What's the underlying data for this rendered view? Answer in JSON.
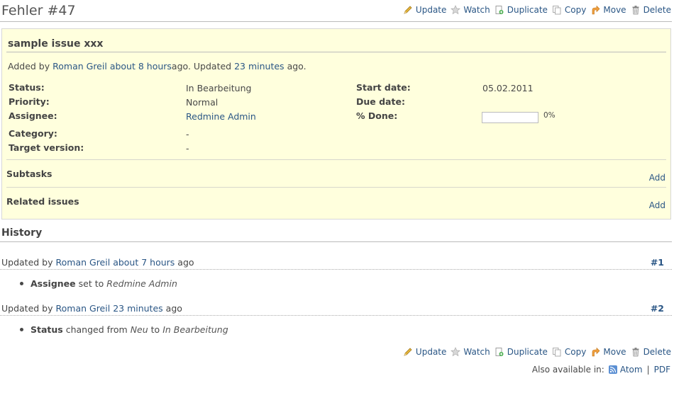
{
  "issue": {
    "title": "Fehler #47",
    "subject": "sample issue xxx",
    "author_prefix": "Added by",
    "author": "Roman Greil",
    "added_ago": "about 8 hours",
    "added_suffix": "ago. Updated",
    "updated_ago": "23 minutes",
    "updated_suffix": "ago."
  },
  "actions": {
    "update": "Update",
    "watch": "Watch",
    "duplicate": "Duplicate",
    "copy": "Copy",
    "move": "Move",
    "delete": "Delete"
  },
  "attributes": {
    "status_label": "Status:",
    "status_value": "In Bearbeitung",
    "priority_label": "Priority:",
    "priority_value": "Normal",
    "assignee_label": "Assignee:",
    "assignee_value": "Redmine Admin",
    "category_label": "Category:",
    "category_value": "-",
    "target_label": "Target version:",
    "target_value": "-",
    "start_label": "Start date:",
    "start_value": "05.02.2011",
    "due_label": "Due date:",
    "due_value": "",
    "done_label": "% Done:",
    "done_value": "0%",
    "done_fraction": 0
  },
  "sections": {
    "subtasks": "Subtasks",
    "related": "Related issues",
    "add": "Add"
  },
  "history": {
    "title": "History",
    "journals": [
      {
        "prefix": "Updated by",
        "author": "Roman Greil",
        "ago": "about 7 hours",
        "suffix": "ago",
        "number": "#1",
        "field": "Assignee",
        "verb": "set to",
        "new_value": "Redmine Admin"
      },
      {
        "prefix": "Updated by",
        "author": "Roman Greil",
        "ago": "23 minutes",
        "suffix": "ago",
        "number": "#2",
        "field": "Status",
        "verb": "changed from",
        "old_value": "Neu",
        "to": "to",
        "new_value": "In Bearbeitung"
      }
    ]
  },
  "footer": {
    "also_available": "Also available in:",
    "atom": "Atom",
    "separator": "|",
    "pdf": "PDF"
  },
  "icons": {
    "update": "pencil-icon",
    "watch": "star-icon",
    "duplicate": "duplicate-icon",
    "copy": "copy-icon",
    "move": "move-arrow-icon",
    "delete": "trash-icon",
    "atom": "feed-icon"
  },
  "colors": {
    "link": "#2a5685",
    "issue_background": "#ffffdd",
    "border": "#d7d7d7"
  }
}
